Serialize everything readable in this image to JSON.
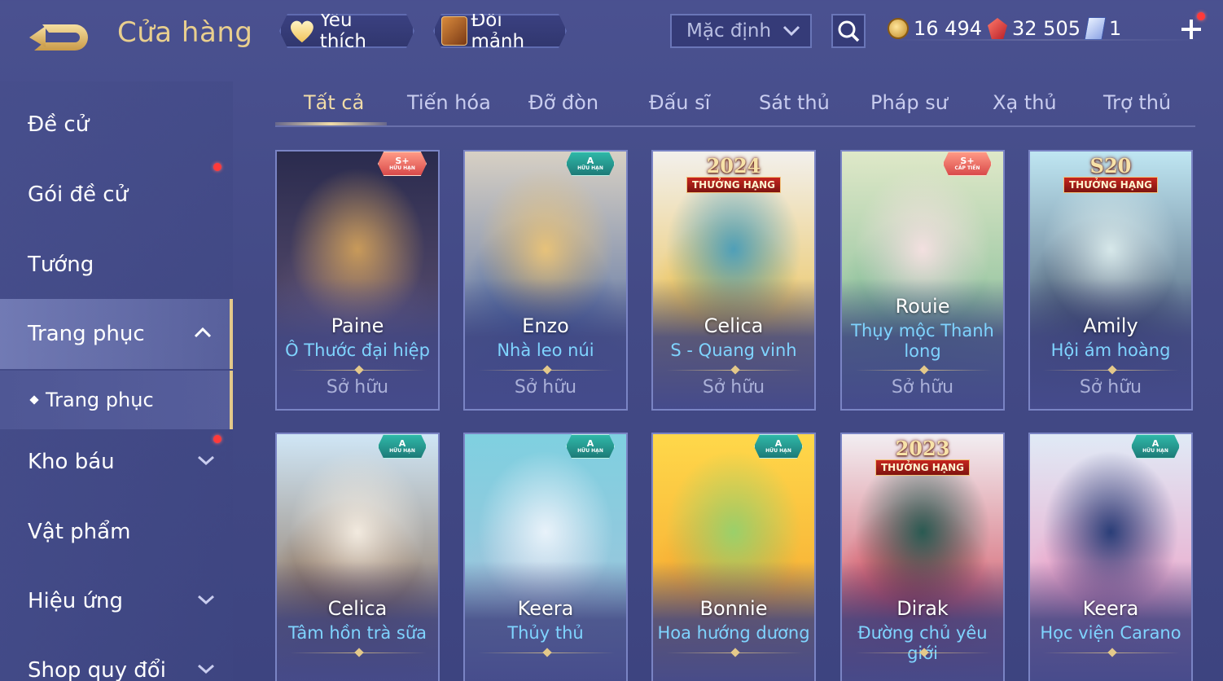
{
  "header": {
    "title": "Cửa hàng",
    "favorites_label": "Yêu thích",
    "exchange_label": "Đổi mảnh",
    "sort_value": "Mặc định"
  },
  "currencies": {
    "gold": "16 494",
    "ruby": "32 505",
    "voucher": "1"
  },
  "sidebar": {
    "items": [
      {
        "label": "Đề cử"
      },
      {
        "label": "Gói đề cử"
      },
      {
        "label": "Tướng"
      },
      {
        "label": "Trang phục"
      },
      {
        "label": "Trang phục"
      },
      {
        "label": "Kho báu"
      },
      {
        "label": "Vật phẩm"
      },
      {
        "label": "Hiệu ứng"
      },
      {
        "label": "Shop quy đổi"
      }
    ]
  },
  "tabs": [
    "Tất cả",
    "Tiến hóa",
    "Đỡ đòn",
    "Đấu sĩ",
    "Sát thủ",
    "Pháp sư",
    "Xạ thủ",
    "Trợ thủ"
  ],
  "cards": [
    {
      "hero": "Paine",
      "skin": "Ô Thước đại hiệp",
      "status": "Sở hữu",
      "badge_grade": "S+",
      "badge_text": "HỮU HẠN",
      "palette": [
        "#2a2b4e",
        "#6b5a7a",
        "#c89a5a"
      ]
    },
    {
      "hero": "Enzo",
      "skin": "Nhà leo núi",
      "status": "Sở hữu",
      "badge_grade": "A",
      "badge_text": "HỮU HẠN",
      "palette": [
        "#d7d0c4",
        "#3a5a9a",
        "#e7c27a"
      ]
    },
    {
      "hero": "Celica",
      "skin": "S - Quang vinh",
      "status": "Sở hữu",
      "rank_year": "2024",
      "rank_label": "THƯỞNG HẠNG",
      "palette": [
        "#f2f0ec",
        "#e9b42a",
        "#4f9fb8"
      ]
    },
    {
      "hero": "Rouie",
      "skin": "Thụy mộc Thanh long",
      "status": "Sở hữu",
      "badge_grade": "S+",
      "badge_text": "CẤP TIẾN",
      "palette": [
        "#dfe8c8",
        "#6bb08a",
        "#f3e0e0"
      ]
    },
    {
      "hero": "Amily",
      "skin": "Hội ám hoàng",
      "status": "Sở hữu",
      "rank_year": "S20",
      "rank_label": "THƯỞNG HẠNG",
      "palette": [
        "#bfe6f2",
        "#2e3a55",
        "#d7e8ea"
      ]
    },
    {
      "hero": "Celica",
      "skin": "Tâm hồn trà sữa",
      "status": "",
      "badge_grade": "A",
      "badge_text": "HỮU HẠN",
      "palette": [
        "#cfe6f6",
        "#7a5232",
        "#f2eadf"
      ]
    },
    {
      "hero": "Keera",
      "skin": "Thủy thủ",
      "status": "",
      "badge_grade": "A",
      "badge_text": "HỮU HẠN",
      "palette": [
        "#7fd0e0",
        "#a8c0da",
        "#e8f2fa"
      ]
    },
    {
      "hero": "Bonnie",
      "skin": "Hoa hướng dương",
      "status": "",
      "badge_grade": "A",
      "badge_text": "HỮU HẠN",
      "palette": [
        "#ffd84a",
        "#f29a2a",
        "#9ad06a"
      ]
    },
    {
      "hero": "Dirak",
      "skin": "Đường chủ yêu giới",
      "status": "",
      "rank_year": "2023",
      "rank_label": "THƯỞNG HẠNG",
      "palette": [
        "#f2eef2",
        "#c8283a",
        "#2a5a52"
      ]
    },
    {
      "hero": "Keera",
      "skin": "Học viện Carano",
      "status": "",
      "badge_grade": "A",
      "badge_text": "HỮU HẠN",
      "palette": [
        "#e0eaf6",
        "#f08ab8",
        "#2a3e78"
      ]
    }
  ],
  "colors": {
    "accent_gold": "#e9cf8e",
    "skin_name": "#7fd4ff",
    "background": "#454b8c"
  }
}
